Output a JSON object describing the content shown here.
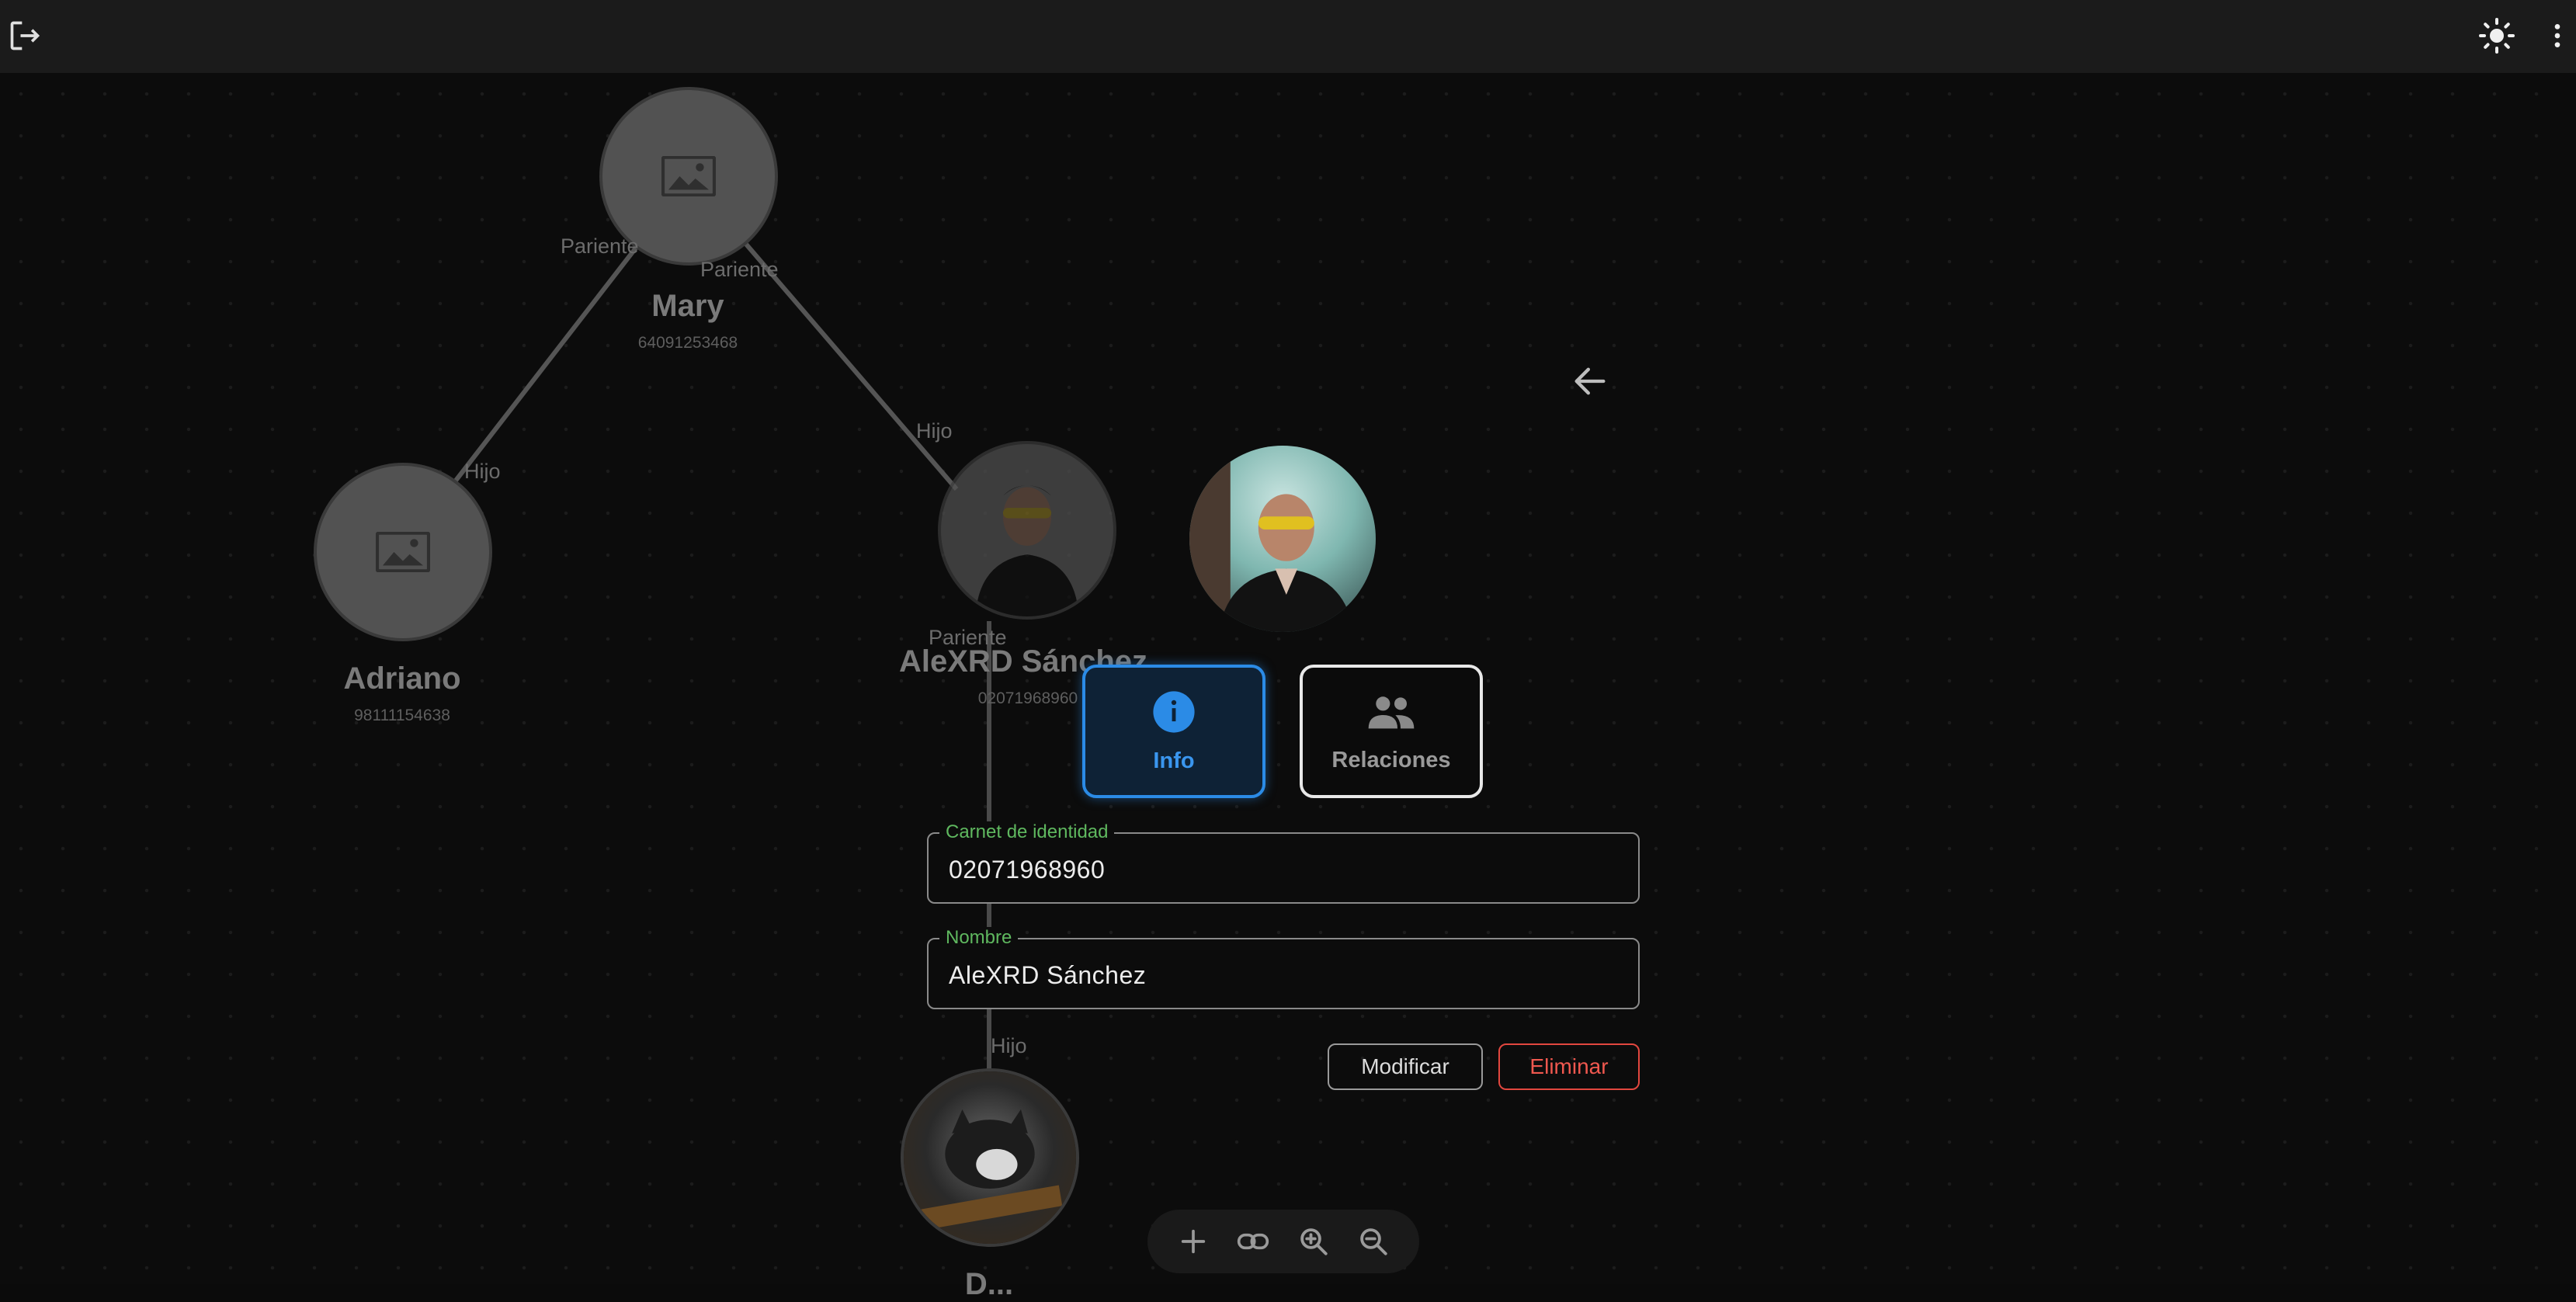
{
  "appbar": {
    "logout_icon": "logout-icon",
    "theme_icon": "sun-icon",
    "menu_icon": "more-vertical-icon"
  },
  "graph": {
    "nodes": [
      {
        "key": "mary",
        "name": "Mary",
        "id": "64091253468",
        "image": "placeholder-image-icon"
      },
      {
        "key": "adriano",
        "name": "Adriano",
        "id": "98111154638",
        "image": "placeholder-image-icon"
      },
      {
        "key": "alexrd",
        "name": "AleXRD Sánchez",
        "id": "02071968960",
        "image": "photo"
      },
      {
        "key": "bottom",
        "name": "D...",
        "id": "",
        "image": "photo-cat"
      }
    ],
    "edge_labels": {
      "mary_left_parent": "Pariente",
      "mary_right_parent": "Pariente",
      "adriano_child": "Hijo",
      "alexrd_child_top": "Hijo",
      "alexrd_parent_bottom": "Pariente",
      "bottom_child": "Hijo"
    }
  },
  "panel": {
    "back_icon": "arrow-left-icon",
    "tabs": [
      {
        "label": "Info",
        "icon": "info-icon",
        "active": true
      },
      {
        "label": "Relaciones",
        "icon": "people-icon",
        "active": false
      }
    ],
    "fields": {
      "carnet": {
        "label": "Carnet de identidad",
        "value": "02071968960"
      },
      "nombre": {
        "label": "Nombre",
        "value": "AleXRD Sánchez"
      }
    },
    "buttons": {
      "modify": "Modificar",
      "delete": "Eliminar"
    }
  },
  "toolbar": {
    "items": [
      "add-icon",
      "link-icon",
      "zoom-in-icon",
      "zoom-out-icon"
    ]
  },
  "colors": {
    "accent": "#2b8be6",
    "field_label": "#5fb85f",
    "danger": "#e2473f"
  }
}
